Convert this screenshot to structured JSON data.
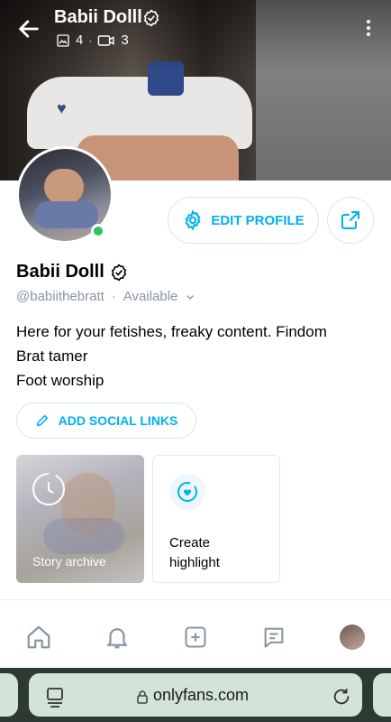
{
  "header": {
    "title": "Babii Dolll",
    "photos_count": "4",
    "videos_count": "3",
    "separator": "·"
  },
  "profile": {
    "name": "Babii Dolll",
    "handle": "@babiithebratt",
    "status": "Available",
    "separator": "·",
    "bio": [
      "Here for your fetishes, freaky content. Findom",
      "Brat tamer",
      "Foot worship"
    ],
    "online": true
  },
  "actions": {
    "edit_profile": "EDIT PROFILE",
    "add_social_links": "ADD SOCIAL LINKS"
  },
  "highlights": {
    "story_archive": "Story archive",
    "create_line1": "Create",
    "create_line2": "highlight"
  },
  "browser": {
    "url": "onlyfans.com"
  },
  "colors": {
    "accent": "#00aff0",
    "online": "#2ec55b",
    "browser_bar": "#2d3a33",
    "url_pill": "#d2e3d7"
  },
  "icons": {
    "back": "arrow-left-icon",
    "verified": "verified-badge-icon",
    "photos": "image-icon",
    "videos": "video-icon",
    "menu": "more-vertical-icon",
    "settings": "gear-icon",
    "share": "share-icon",
    "pencil": "pencil-icon",
    "story": "story-archive-icon",
    "highlight": "heart-highlight-icon",
    "nav": [
      "home-icon",
      "bell-icon",
      "plus-square-icon",
      "message-icon",
      "avatar"
    ],
    "browser": [
      "tabs-icon",
      "lock-icon",
      "reload-icon"
    ]
  }
}
